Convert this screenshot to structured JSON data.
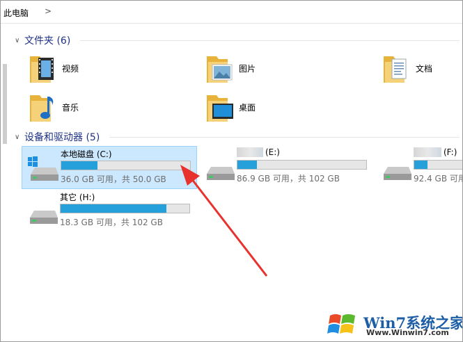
{
  "breadcrumb": {
    "location": "此电脑",
    "chevron": ">"
  },
  "folders_section": {
    "title": "文件夹 (6)",
    "items": [
      {
        "label": "视频",
        "icon": "video-folder-icon"
      },
      {
        "label": "图片",
        "icon": "pictures-folder-icon"
      },
      {
        "label": "文档",
        "icon": "documents-folder-icon"
      },
      {
        "label": "音乐",
        "icon": "music-folder-icon"
      },
      {
        "label": "桌面",
        "icon": "desktop-folder-icon"
      }
    ]
  },
  "devices_section": {
    "title": "设备和驱动器 (5)",
    "drives": [
      {
        "name": "本地磁盘 (C:)",
        "free_text": "36.0 GB 可用，共 50.0 GB",
        "used_fraction": 0.28,
        "selected": true
      },
      {
        "name": "(E:)",
        "free_text": "86.9 GB 可用，共 102 GB",
        "used_fraction": 0.15,
        "selected": false
      },
      {
        "name": "(F:)",
        "free_text": "92.4 GB 可用，共",
        "used_fraction": 0.1,
        "selected": false
      },
      {
        "name": "其它 (H:)",
        "free_text": "18.3 GB 可用，共 102 GB",
        "used_fraction": 0.82,
        "selected": false
      }
    ]
  },
  "watermark": {
    "brand": "Win7系统之家",
    "url": "Www.Winwin7.com"
  },
  "colors": {
    "accent": "#26a0da",
    "header_text": "#1e3287",
    "selection": "#cce8ff",
    "arrow": "#e8322e"
  }
}
